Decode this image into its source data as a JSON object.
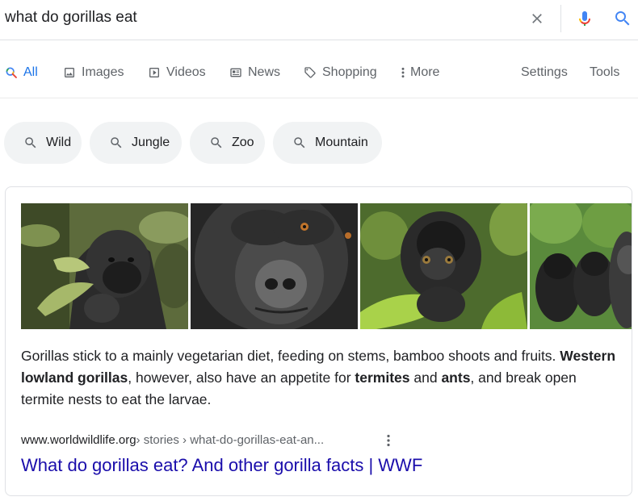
{
  "search": {
    "query": "what do gorillas eat"
  },
  "tabs": [
    {
      "label": "All",
      "icon": "search-icon",
      "active": true
    },
    {
      "label": "Images",
      "icon": "image-icon"
    },
    {
      "label": "Videos",
      "icon": "video-icon"
    },
    {
      "label": "News",
      "icon": "news-icon"
    },
    {
      "label": "Shopping",
      "icon": "tag-icon"
    },
    {
      "label": "More",
      "icon": "more-vertical-icon"
    }
  ],
  "tools": {
    "settings_label": "Settings",
    "tools_label": "Tools"
  },
  "chips": [
    "Wild",
    "Jungle",
    "Zoo",
    "Mountain"
  ],
  "snippet": {
    "images": [
      "gorilla-eating-leaves-image",
      "gorilla-face-closeup-image",
      "baby-gorilla-eating-image",
      "gorilla-family-image"
    ],
    "segments": [
      {
        "text": "Gorillas stick to a mainly vegetarian diet, feeding on stems, bamboo shoots and fruits. ",
        "bold": false
      },
      {
        "text": "Western lowland gorillas",
        "bold": true
      },
      {
        "text": ", however, also have an appetite for ",
        "bold": false
      },
      {
        "text": "termites",
        "bold": true
      },
      {
        "text": " and ",
        "bold": false
      },
      {
        "text": "ants",
        "bold": true
      },
      {
        "text": ", and break open termite nests to eat the larvae.",
        "bold": false
      }
    ],
    "domain": "www.worldwildlife.org",
    "breadcrumbs": " › stories › what-do-gorillas-eat-an...",
    "title": "What do gorillas eat? And other gorilla facts | WWF"
  },
  "colors": {
    "link": "#1a0dab",
    "accent": "#1a73e8",
    "muted": "#5f6368",
    "chip_bg": "#f1f3f4"
  }
}
